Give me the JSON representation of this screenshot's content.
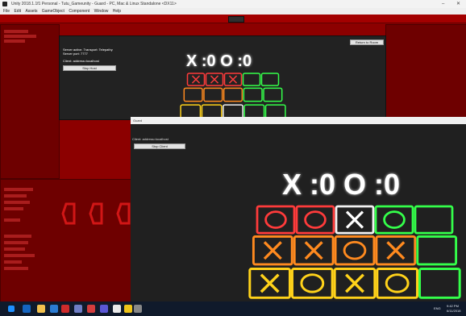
{
  "window": {
    "title": "Unity 2018.1.1f1 Personal - Tutu_Gameunity - Guard - PC, Mac & Linux Standalone <DX11>",
    "min": "–",
    "close": "✕"
  },
  "menu": [
    "File",
    "Edit",
    "Assets",
    "GameObject",
    "Component",
    "Window",
    "Help"
  ],
  "game_view": {
    "return_button": "Return to Room",
    "server_active": "Server active. Transport: Telepathy",
    "server_port": "Server port: 7777",
    "client_address": "Client: address=localhost",
    "stop_host": "Stop Host",
    "score": "X :0 O :0"
  },
  "client_window": {
    "title": "Guard",
    "client_address": "Client: address=localhost",
    "stop_client": "Stop Client",
    "score": "X :0 O :0"
  },
  "board_top": {
    "rows": [
      [
        "X",
        "X",
        "X",
        "",
        ""
      ],
      [
        "",
        "",
        "",
        "",
        ""
      ],
      [
        "",
        "",
        "",
        "",
        ""
      ]
    ]
  },
  "board_client": {
    "rows": [
      [
        "O",
        "O",
        "X",
        "O",
        ""
      ],
      [
        "X",
        "X",
        "O",
        "X",
        ""
      ],
      [
        "X",
        "O",
        "X",
        "O",
        ""
      ]
    ]
  },
  "taskbar": {
    "time": "9:42 PM",
    "date": "6/11/2018",
    "lang": "ENG"
  },
  "colors": {
    "editor_red": "#8c0000",
    "neon_red": "#ff3b3b",
    "neon_orange": "#ff8a1f",
    "neon_yellow": "#ffd21a",
    "neon_green": "#34ff4a",
    "neon_white": "#f2f2f2",
    "handle_red": "#d11616",
    "taskbar_bg": "#101a2b"
  }
}
